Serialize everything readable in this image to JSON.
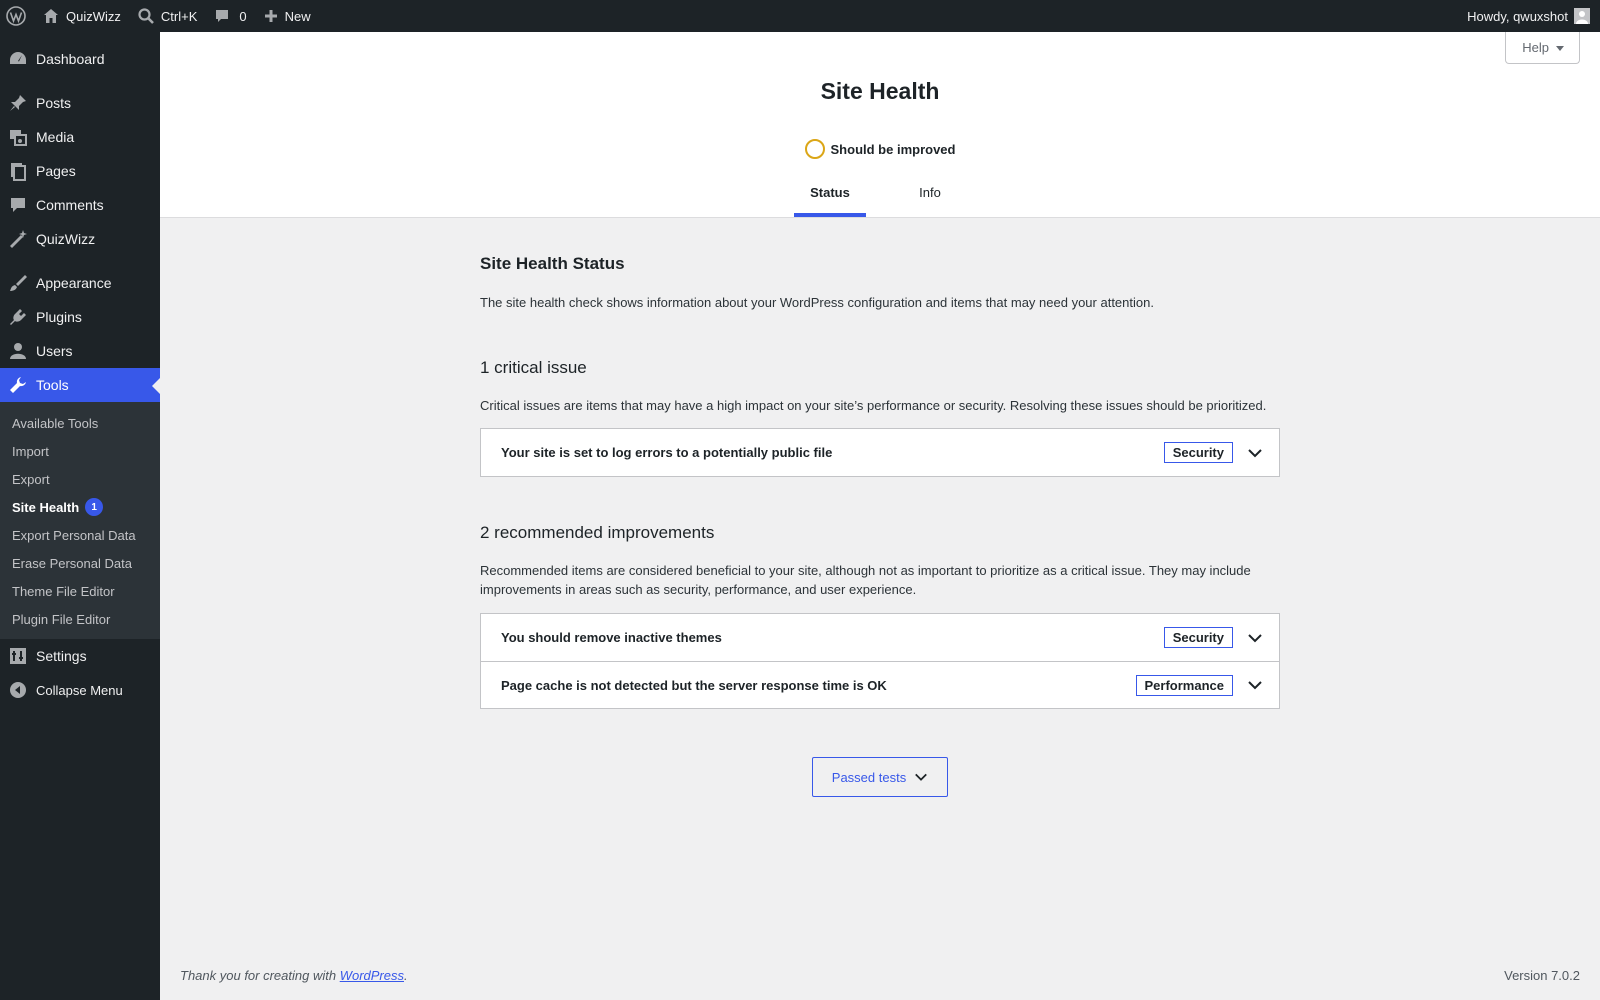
{
  "adminbar": {
    "site_name": "QuizWizz",
    "search_shortcut": "Ctrl+K",
    "comments_count": "0",
    "new_label": "New",
    "howdy": "Howdy, qwuxshot"
  },
  "sidebar": {
    "items": [
      {
        "label": "Dashboard",
        "icon": "dashboard-icon"
      },
      {
        "label": "Posts",
        "icon": "pin-icon"
      },
      {
        "label": "Media",
        "icon": "media-icon"
      },
      {
        "label": "Pages",
        "icon": "pages-icon"
      },
      {
        "label": "Comments",
        "icon": "comment-icon"
      },
      {
        "label": "QuizWizz",
        "icon": "magic-wand-icon"
      },
      {
        "label": "Appearance",
        "icon": "paintbrush-icon"
      },
      {
        "label": "Plugins",
        "icon": "plugin-icon"
      },
      {
        "label": "Users",
        "icon": "users-icon"
      },
      {
        "label": "Tools",
        "icon": "wrench-icon"
      },
      {
        "label": "Settings",
        "icon": "settings-icon"
      },
      {
        "label": "Collapse Menu",
        "icon": "collapse-icon"
      }
    ],
    "tools_submenu": [
      "Available Tools",
      "Import",
      "Export",
      "Site Health",
      "Export Personal Data",
      "Erase Personal Data",
      "Theme File Editor",
      "Plugin File Editor"
    ],
    "site_health_count": "1"
  },
  "header": {
    "help_label": "Help",
    "title": "Site Health",
    "status": "Should be improved",
    "tabs": [
      "Status",
      "Info"
    ]
  },
  "main": {
    "status_title": "Site Health Status",
    "status_desc": "The site health check shows information about your WordPress configuration and items that may need your attention.",
    "critical_title": "1 critical issue",
    "critical_desc": "Critical issues are items that may have a high impact on your site’s performance or security. Resolving these issues should be prioritized.",
    "critical_issues": [
      {
        "title": "Your site is set to log errors to a potentially public file",
        "badge": "Security"
      }
    ],
    "recommended_title": "2 recommended improvements",
    "recommended_desc": "Recommended items are considered beneficial to your site, although not as important to prioritize as a critical issue. They may include improvements in areas such as security, performance, and user experience.",
    "recommended_issues": [
      {
        "title": "You should remove inactive themes",
        "badge": "Security"
      },
      {
        "title": "Page cache is not detected but the server response time is OK",
        "badge": "Performance"
      }
    ],
    "passed_tests_label": "Passed tests"
  },
  "footer": {
    "thanks_prefix": "Thank you for creating with ",
    "wordpress_link": "WordPress",
    "thanks_suffix": ".",
    "version": "Version 7.0.2"
  },
  "colors": {
    "accent": "#3858e9",
    "warning_ring": "#dba617",
    "adminbar_bg": "#1d2327"
  }
}
